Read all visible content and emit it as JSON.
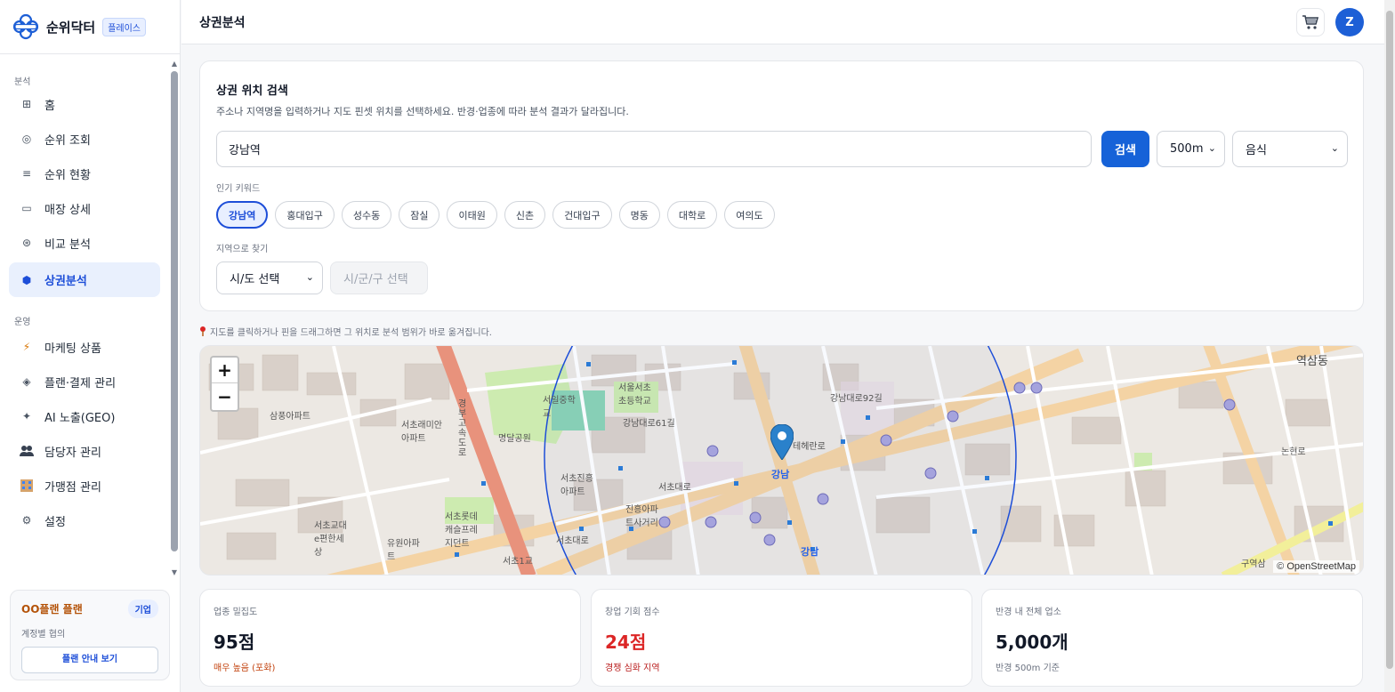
{
  "brand": {
    "name": "순위닥터",
    "badge": "플레이스"
  },
  "nav": {
    "section_analysis": "분석",
    "section_ops": "운영",
    "items": [
      {
        "label": "홈",
        "icon": "grid-icon"
      },
      {
        "label": "순위 조회",
        "icon": "target-icon"
      },
      {
        "label": "순위 현황",
        "icon": "list-icon"
      },
      {
        "label": "매장 상세",
        "icon": "store-icon"
      },
      {
        "label": "비교 분석",
        "icon": "compare-icon"
      },
      {
        "label": "상권분석",
        "icon": "hexagon-icon",
        "active": true
      }
    ],
    "ops_items": [
      {
        "label": "마케팅 상품",
        "icon": "lightning-icon"
      },
      {
        "label": "플랜·결제 관리",
        "icon": "diamond-icon"
      },
      {
        "label": "AI 노출(GEO)",
        "icon": "sparkle-icon"
      },
      {
        "label": "담당자 관리",
        "icon": "people-icon"
      },
      {
        "label": "가맹점 관리",
        "icon": "building-icon"
      },
      {
        "label": "설정",
        "icon": "gear-icon"
      }
    ]
  },
  "plan": {
    "title": "OO플랜 플랜",
    "tag": "기업",
    "subtitle": "계정별 협의",
    "button": "플랜 안내 보기"
  },
  "header": {
    "title": "상권분석",
    "avatar": "Z"
  },
  "search": {
    "title": "상권 위치 검색",
    "description": "주소나 지역명을 입력하거나 지도 핀셋 위치를 선택하세요. 반경·업종에 따라 분석 결과가 달라집니다.",
    "value": "강남역",
    "button": "검색",
    "radius": "500m",
    "category": "음식",
    "keywords_label": "인기 키워드",
    "keywords": [
      "강남역",
      "홍대입구",
      "성수동",
      "잠실",
      "이태원",
      "신촌",
      "건대입구",
      "명동",
      "대학로",
      "여의도"
    ],
    "region_label": "지역으로 찾기",
    "sido": "시/도 선택",
    "sigungu": "시/군/구 선택"
  },
  "map": {
    "hint": "지도를 클릭하거나 핀을 드래그하면 그 위치로 분석 범위가 바로 옮겨집니다.",
    "zoom_in": "+",
    "zoom_out": "−",
    "attribution": "© OpenStreetMap",
    "labels": {
      "gangnam": "강남",
      "gangnam2": "강남",
      "yeoksam": "역삼동",
      "teheranro": "테헤란로",
      "seocho_daero": "서초대로",
      "seochodaero2": "서초대로",
      "samdung": "삼풍아파트",
      "raemian": "서초래미안아파트",
      "jinheung": "서초진흥아파트",
      "myungdal": "명달공원",
      "seoil": "서일중학교",
      "seoun": "서울서초초등학교",
      "gyeongbu": "경부고속도로",
      "seocho1": "서초1교",
      "jinheung2": "진흥아파트사거리",
      "lotte": "서초롯데캐슬프레지던트",
      "yuwon": "유원아파트",
      "gyodae": "서초교대e편한세상",
      "gangnamdaero": "강남대로",
      "gangnam92": "강남대로92길",
      "gangnam61": "강남대로61길",
      "nonhyeon": "논현로",
      "gumyeok": "구역삼"
    }
  },
  "stats": [
    {
      "label": "업종 밀집도",
      "value": "95점",
      "sub": "매우 높음 (포화)"
    },
    {
      "label": "창업 기회 점수",
      "value": "24점",
      "sub": "경쟁 심화 지역"
    },
    {
      "label": "반경 내 전체 업소",
      "value": "5,000개",
      "sub": "반경 500m 기준"
    }
  ],
  "colors": {
    "accent": "#1662d8",
    "sidebar_active_bg": "#e9f0fd",
    "danger": "#dc2626",
    "warning": "#c2410c",
    "major_road": "#f4d3a4",
    "highway": "#e8927c",
    "park": "#cdebb0",
    "radius_circle": "#2563eb"
  }
}
